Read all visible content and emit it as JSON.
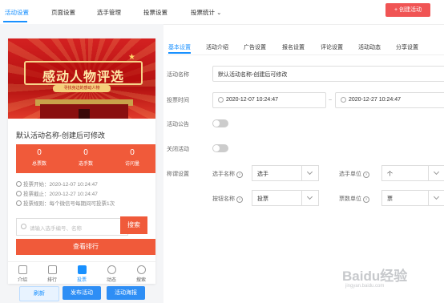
{
  "top_nav": {
    "tabs": [
      "活动设置",
      "页面设置",
      "选手管理",
      "投票设置",
      "投票统计"
    ],
    "create_button": "+ 创建活动"
  },
  "preview": {
    "banner_title": "感动人物评选",
    "banner_subtitle": "寻找身边的感动人物",
    "activity_name": "默认活动名称-创建后可修改",
    "stats": [
      {
        "value": "0",
        "label": "总票数"
      },
      {
        "value": "0",
        "label": "选手数"
      },
      {
        "value": "0",
        "label": "访问量"
      }
    ],
    "meta": [
      "投票开始：2020-12-07 10:24:47",
      "投票截止：2020-12-27 10:24:47",
      "投票规则：每个微信号每期间可投票1次"
    ],
    "search_placeholder": "请输入选手编号、名称",
    "search_button": "搜索",
    "rank_button": "查看排行",
    "bottom_nav": [
      "介绍",
      "排行",
      "投票",
      "动态",
      "搜索"
    ],
    "actions": {
      "refresh": "刷新",
      "publish": "发布活动",
      "poster": "活动海报"
    }
  },
  "settings": {
    "tabs": [
      "基本设置",
      "活动介绍",
      "广告设置",
      "报名设置",
      "评论设置",
      "活动动态",
      "分享设置"
    ],
    "activity_name_label": "活动名称",
    "activity_name_value": "默认活动名称-创建后可修改",
    "vote_time_label": "投票时间",
    "start_time": "2020-12-07 10:24:47",
    "time_separator": "~",
    "end_time": "2020-12-27 10:24:47",
    "announcement_label": "活动公告",
    "close_activity_label": "关闭活动",
    "naming_label": "称谓设置",
    "player_name_label": "选手名称",
    "player_name_value": "选手",
    "player_unit_label": "选手单位",
    "player_unit_value": "个",
    "button_name_label": "按钮名称",
    "button_name_value": "投票",
    "vote_unit_label": "票数单位",
    "vote_unit_value": "票"
  },
  "watermark": {
    "logo": "Baidu经验",
    "sub": "jingyan.baidu.com"
  }
}
